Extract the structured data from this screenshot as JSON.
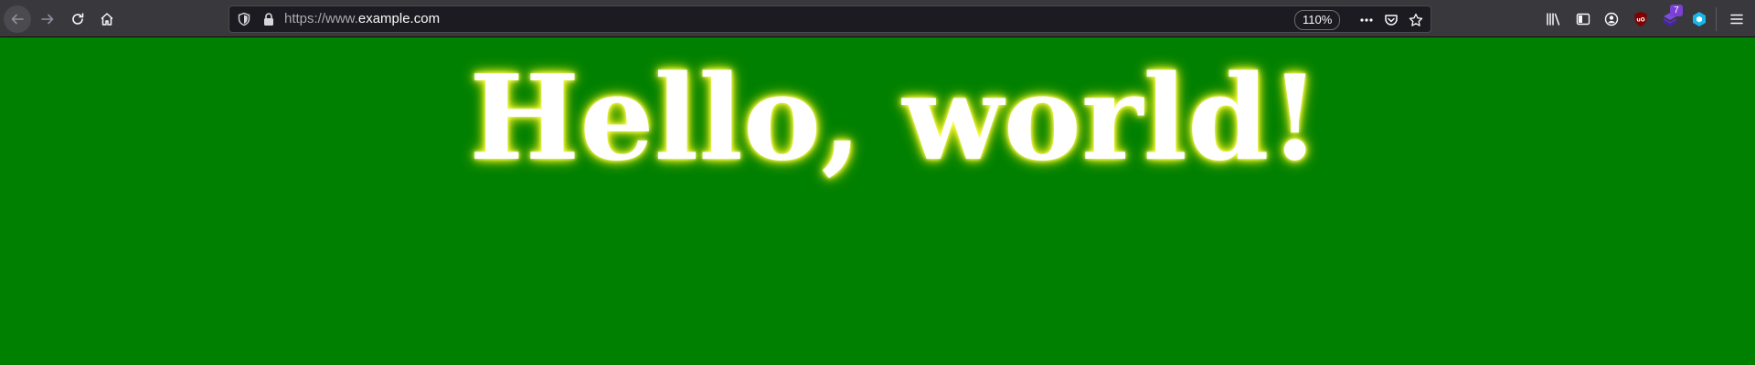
{
  "browser": {
    "url": {
      "prefix": "https://www.",
      "domain": "example.com"
    },
    "zoom_level": "110%",
    "extension_badge_count": "7",
    "icons": {
      "back": "back-arrow-icon",
      "forward": "forward-arrow-icon",
      "reload": "reload-icon",
      "home": "home-icon",
      "tracking_protection": "shield-icon",
      "connection": "lock-icon",
      "page_actions": "more-icon",
      "pocket": "pocket-icon",
      "bookmark": "star-icon",
      "library": "library-icon",
      "sidebar": "sidebar-icon",
      "account": "account-icon",
      "ublock": "ublock-origin-icon",
      "extension_purple": "extension-purple-icon",
      "extension_blue": "extension-blue-icon",
      "menu": "hamburger-menu-icon"
    }
  },
  "page": {
    "heading": "Hello, world!",
    "colors": {
      "background": "#008000",
      "heading_text": "#ffffff",
      "heading_glow": "#ffff33"
    }
  }
}
